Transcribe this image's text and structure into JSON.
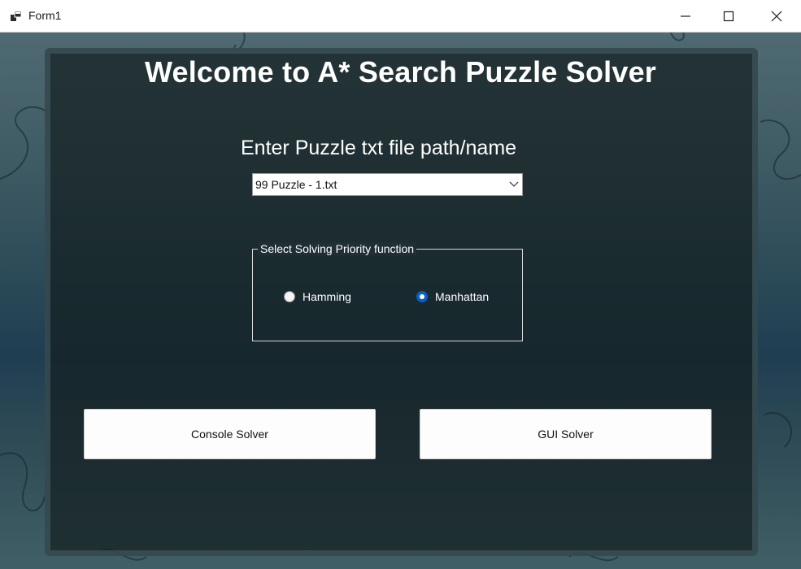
{
  "window": {
    "title": "Form1",
    "app_icon": "windows-form-icon",
    "controls": [
      "minimize-icon",
      "maximize-icon",
      "close-icon"
    ]
  },
  "main": {
    "heading": "Welcome to A* Search Puzzle Solver",
    "file_prompt": "Enter Puzzle txt file path/name",
    "file_select": {
      "value": "99 Puzzle - 1.txt"
    },
    "priority_group": {
      "legend": "Select Solving Priority function",
      "options": [
        {
          "label": "Hamming",
          "checked": false
        },
        {
          "label": "Manhattan",
          "checked": true
        }
      ]
    },
    "buttons": {
      "console": "Console Solver",
      "gui": "GUI Solver"
    }
  },
  "colors": {
    "radio_selected": "#0a5fc4",
    "panel": "#1f2f33"
  }
}
